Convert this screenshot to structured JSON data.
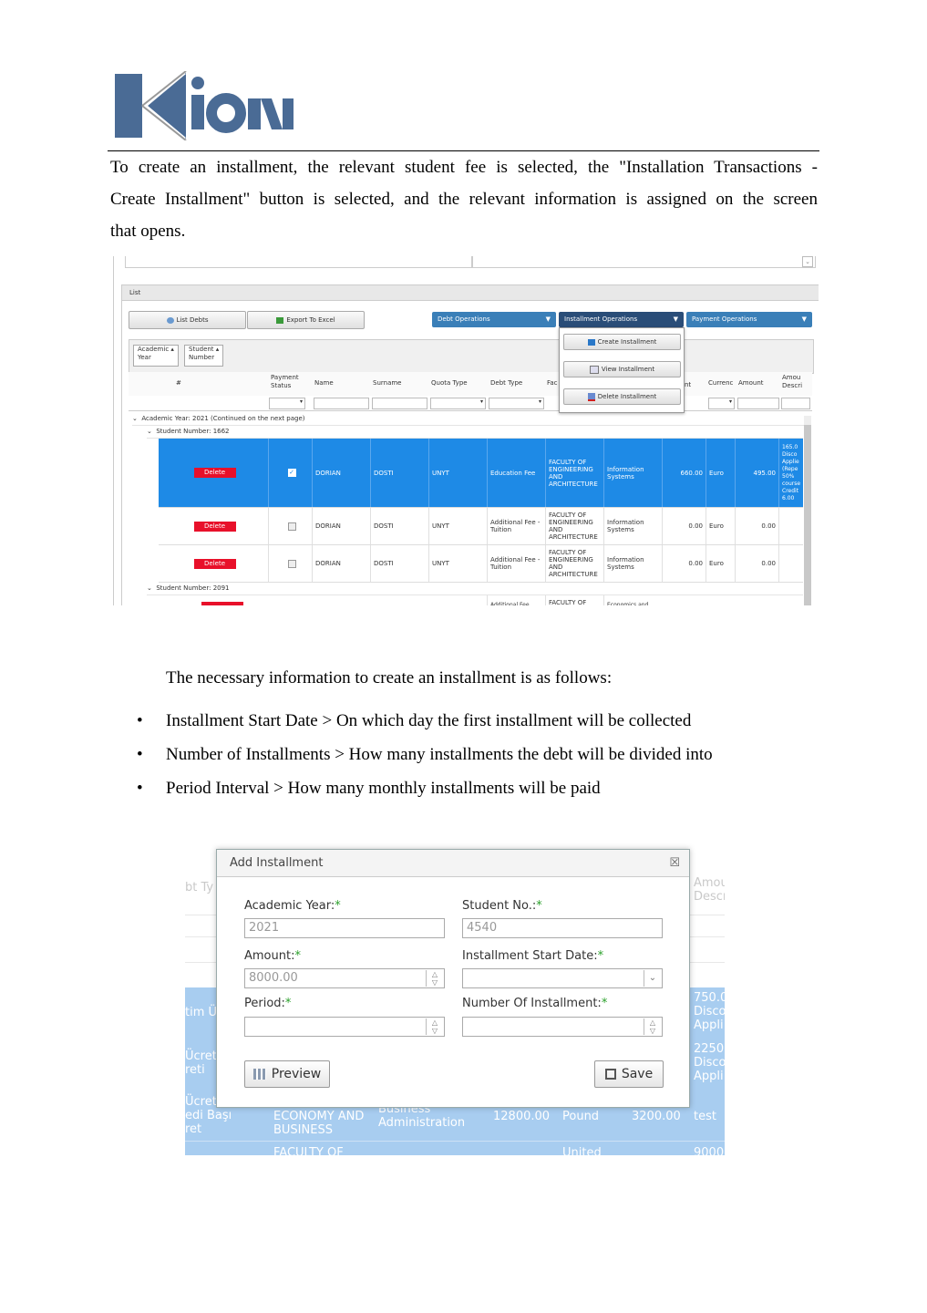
{
  "header": {
    "logo_text": "Kion",
    "colors": {
      "logo_blue": "#4a6b95",
      "logo_gray": "#5a6f8a"
    }
  },
  "intro_paragraph": {
    "line1": "To create an installment, the relevant student fee is selected, the \"Installation Transactions -",
    "line2": "Create Installment\" button is selected, and the relevant information is assigned on the screen",
    "line3": "that opens."
  },
  "screenshot1": {
    "list_label": "List",
    "buttons": {
      "list_debts": "List Debts",
      "export_excel": "Export To Excel"
    },
    "operations": {
      "debt": "Debt Operations",
      "installment": "Installment Operations",
      "payment": "Payment Operations"
    },
    "dropdown": {
      "create": "Create Installment",
      "view": "View Installment",
      "delete": "Delete Installment"
    },
    "group_chips": {
      "academic_year": [
        "Academic",
        "Year"
      ],
      "student_number": [
        "Student",
        "Number"
      ]
    },
    "columns": {
      "hash": "#",
      "payment_status": [
        "Payment",
        "Status"
      ],
      "name": "Name",
      "surname": "Surname",
      "quota_type": "Quota Type",
      "debt_type": "Debt Type",
      "faculty": "Fac",
      "amount_partial": "nt",
      "currency": "Currenc",
      "amount": "Amount",
      "amount_desc": [
        "Amou",
        "Descri"
      ]
    },
    "group_year": "Academic Year: 2021 (Continued on the next page)",
    "group_student1": "Student Number: 1662",
    "group_student2": "Student Number: 2091",
    "delete_label": "Delete",
    "rows": [
      {
        "name": "DORIAN",
        "surname": "DOSTI",
        "quota": "UNYT",
        "debt_type": [
          "Education Fee"
        ],
        "faculty": [
          "FACULTY OF",
          "ENGINEERING",
          "AND",
          "ARCHITECTURE"
        ],
        "program": [
          "Information",
          "Systems"
        ],
        "total": "660.00",
        "currency": "Euro",
        "amount": "495.00",
        "desc": [
          "165.0",
          "Disco",
          "Applie",
          "(Repe",
          "50%",
          "course",
          "Credit",
          "6.00"
        ]
      },
      {
        "name": "DORIAN",
        "surname": "DOSTI",
        "quota": "UNYT",
        "debt_type": [
          "Additional Fee -",
          "Tuition"
        ],
        "faculty": [
          "FACULTY OF",
          "ENGINEERING",
          "AND",
          "ARCHITECTURE"
        ],
        "program": [
          "Information",
          "Systems"
        ],
        "total": "0.00",
        "currency": "Euro",
        "amount": "0.00",
        "desc": []
      },
      {
        "name": "DORIAN",
        "surname": "DOSTI",
        "quota": "UNYT",
        "debt_type": [
          "Additional Fee -",
          "Tuition"
        ],
        "faculty": [
          "FACULTY OF",
          "ENGINEERING",
          "AND",
          "ARCHITECTURE"
        ],
        "program": [
          "Information",
          "Systems"
        ],
        "total": "0.00",
        "currency": "Euro",
        "amount": "0.00",
        "desc": []
      }
    ],
    "partial_row": {
      "debt_type": "Additional Fee",
      "faculty": "FACULTY OF",
      "program": "Economics and"
    },
    "colors": {
      "selected_row": "#1e8ae6",
      "delete_btn": "#e8102a",
      "op_button": "#3a7fb8",
      "op_button_active": "#2a4d78"
    }
  },
  "info_text": "The necessary information to create an installment is as follows:",
  "bullets": [
    "Installment Start Date > On which day the first installment will be collected",
    "Number of Installments > How many installments the debt will be divided into",
    "Period Interval > How many monthly installments will be paid"
  ],
  "dialog": {
    "title": "Add Installment",
    "close_icon": "☒",
    "academic_year_label": "Academic Year:",
    "student_no_label": "Student No.:",
    "amount_label": "Amount:",
    "start_date_label": "Installment Start Date:",
    "period_label": "Period:",
    "num_installment_label": "Number Of Installment:",
    "required_mark": "*",
    "academic_year_value": "2021",
    "student_no_value": "4540",
    "amount_value": "8000.00",
    "period_value": "",
    "start_date_value": "",
    "num_installment_value": "",
    "preview_button": "Preview",
    "save_button": "Save"
  },
  "dialog_background": {
    "left_partial": [
      "bt Ty",
      "tim Ü",
      "Ücret",
      "reti",
      "Ücret",
      "edi Başı",
      "ret"
    ],
    "right_partial": [
      "Amou",
      "Descr",
      "750.0",
      "Disco",
      "Appli",
      "2250",
      "Disco",
      "Appli",
      "9000"
    ],
    "bottom_row": {
      "faculty": [
        "ECONOMY AND",
        "BUSINESS"
      ],
      "program": [
        "Business",
        "Administration"
      ],
      "total": "12800.00",
      "currency": "Pound",
      "amount": "3200.00",
      "desc": "test"
    },
    "last_row": {
      "faculty": "FACULTY OF",
      "currency": "United"
    }
  }
}
